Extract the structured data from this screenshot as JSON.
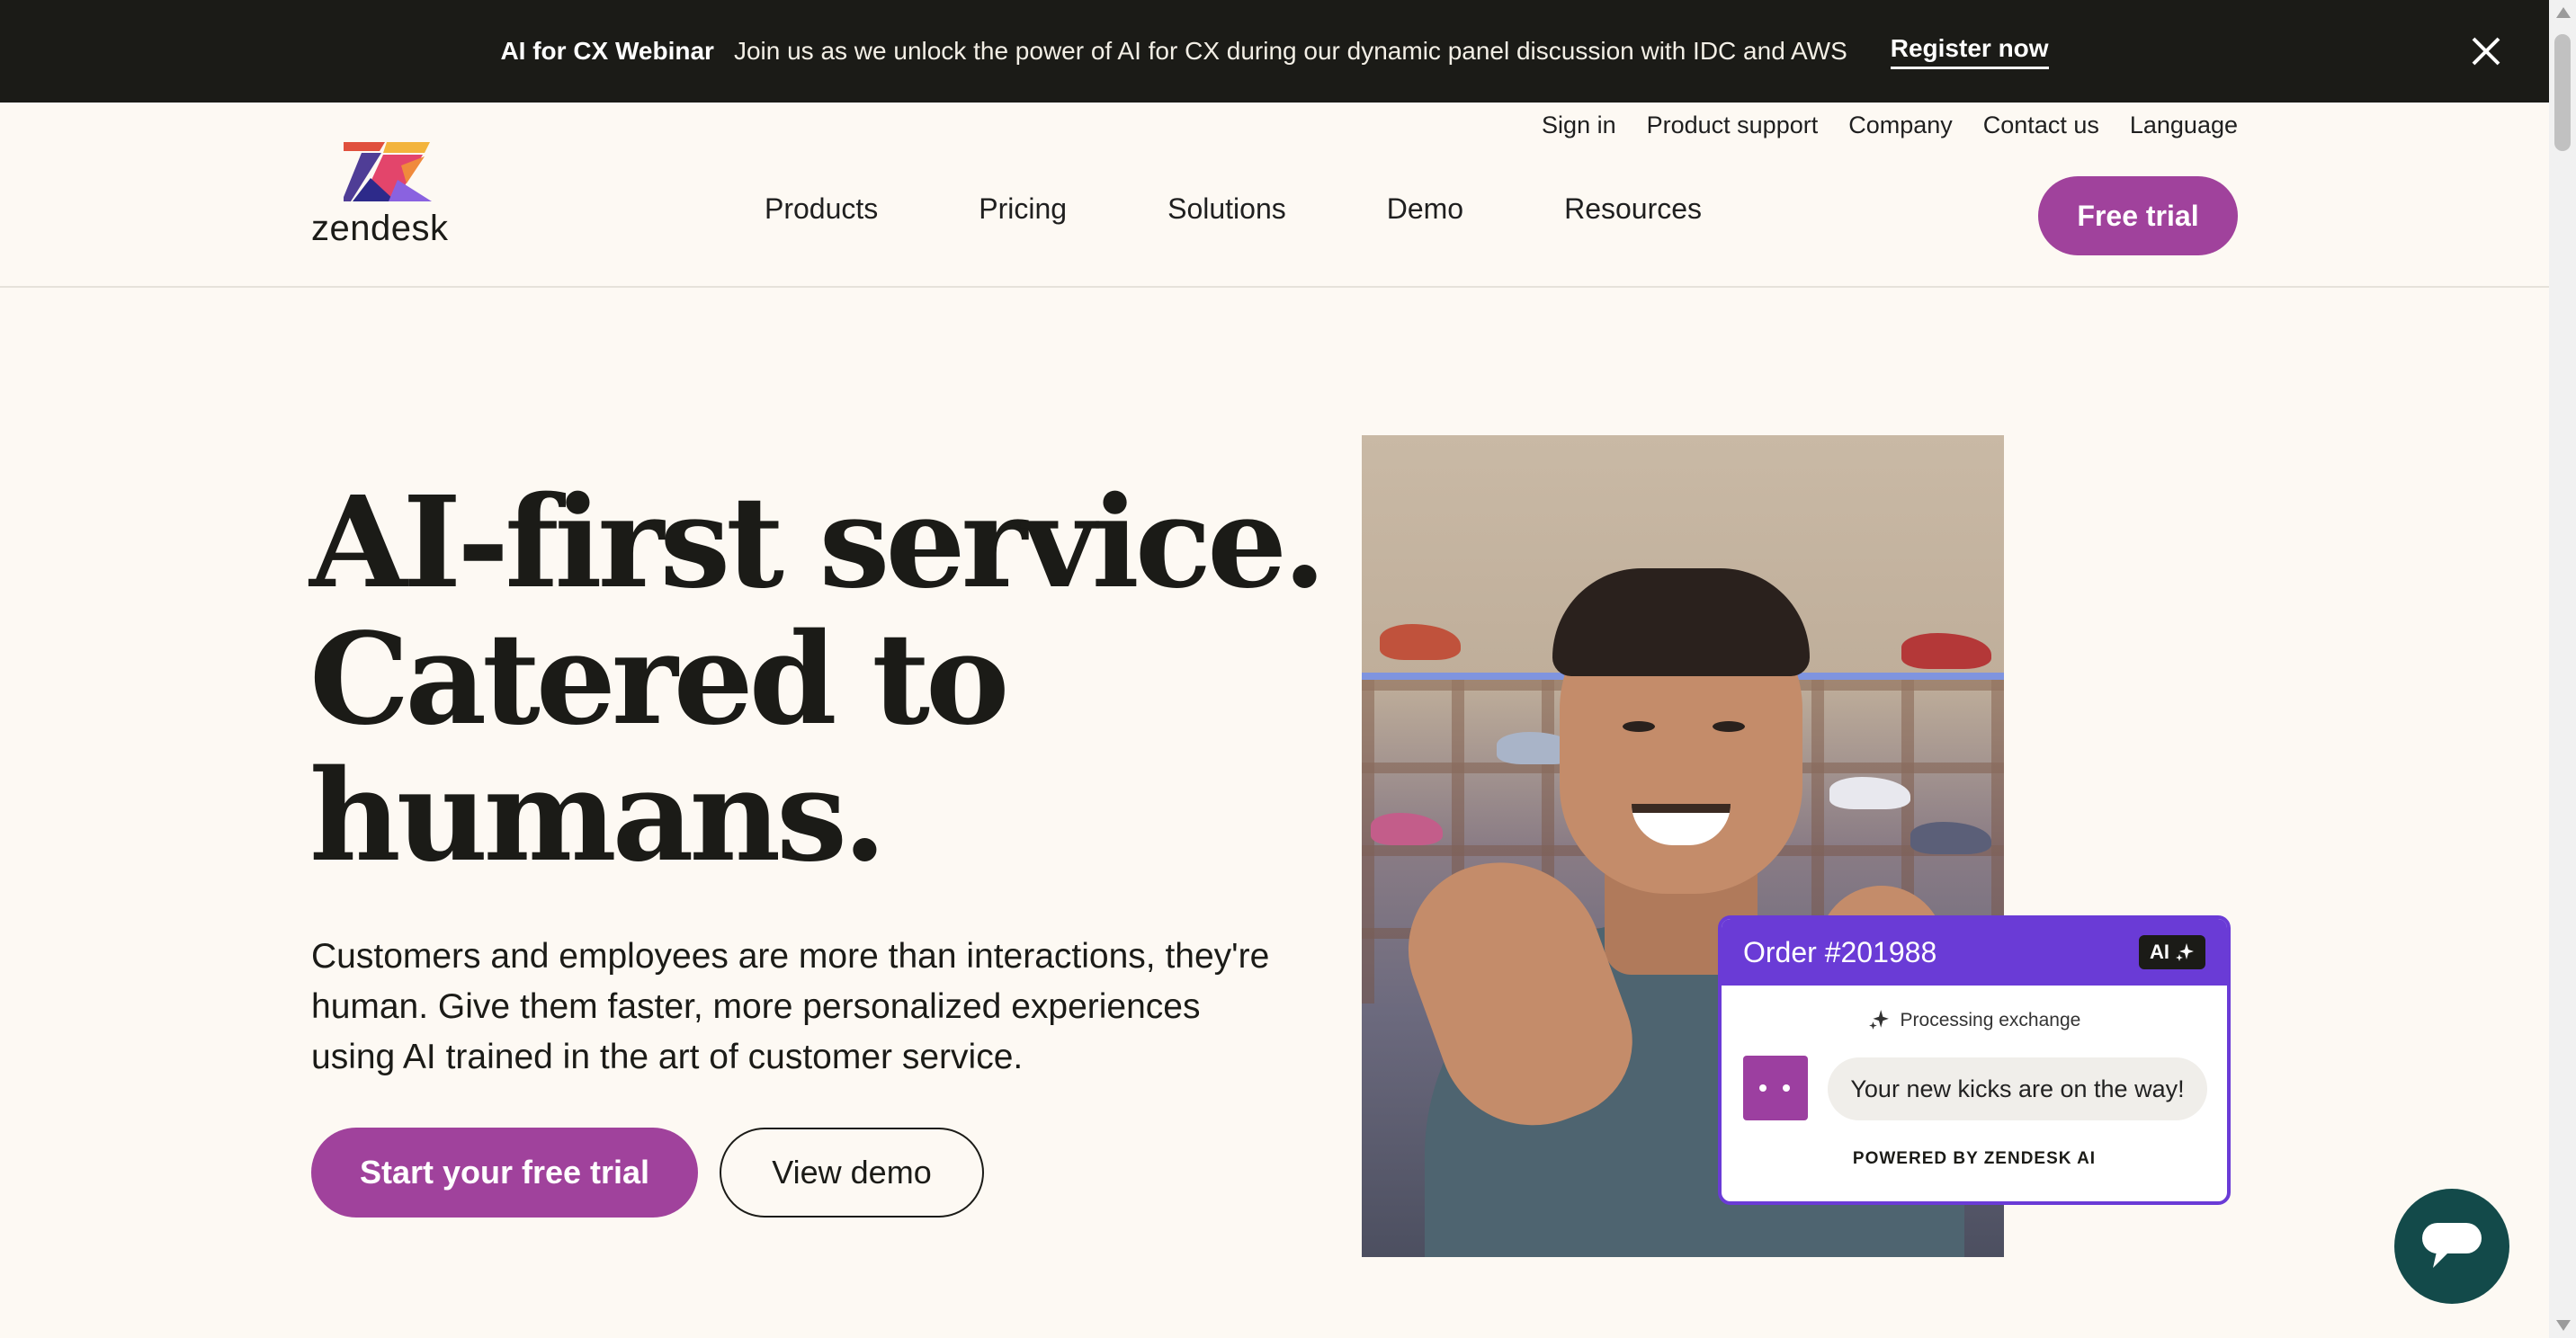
{
  "promo": {
    "title": "AI for CX Webinar",
    "text": "Join us as we unlock the power of AI for CX during our dynamic panel discussion with IDC and AWS",
    "link": "Register now",
    "close_icon": "close-icon"
  },
  "utility_nav": [
    "Sign in",
    "Product support",
    "Company",
    "Contact us",
    "Language"
  ],
  "brand": {
    "name": "zendesk",
    "logo_icon": "zendesk-logo"
  },
  "main_nav": [
    "Products",
    "Pricing",
    "Solutions",
    "Demo",
    "Resources"
  ],
  "header_cta": "Free trial",
  "hero": {
    "title_lines": [
      "AI-first service.",
      "Catered to",
      "humans."
    ],
    "subtitle": "Customers and employees are more than interactions, they're human. Give them faster, more personalized experiences using AI trained in the art of customer service.",
    "primary_cta": "Start your free trial",
    "secondary_cta": "View demo"
  },
  "ai_card": {
    "order": "Order #201988",
    "badge": "AI",
    "status": "Processing exchange",
    "message": "Your new kicks are on the way!",
    "powered_by": "POWERED BY ZENDESK AI"
  },
  "chat_widget": {
    "icon": "chat-bubble-icon"
  },
  "colors": {
    "brand_purple": "#a0429c",
    "promo_bg": "#1b1b17",
    "page_bg": "#fdf9f3",
    "ai_violet": "#6a3bd6",
    "chat_teal": "#134a4a"
  }
}
